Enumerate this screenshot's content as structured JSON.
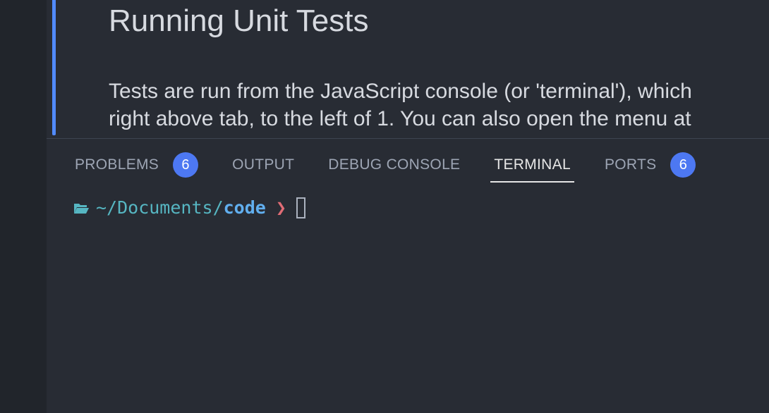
{
  "editor": {
    "heading": "Running Unit Tests",
    "paragraph_lines": [
      "Tests are run from the JavaScript console (or 'terminal'), which",
      "right above tab, to the left of 1. You can also open the menu at"
    ]
  },
  "panel": {
    "tabs": [
      {
        "label": "PROBLEMS",
        "badge": "6"
      },
      {
        "label": "OUTPUT"
      },
      {
        "label": "DEBUG CONSOLE"
      },
      {
        "label": "TERMINAL",
        "active": true
      },
      {
        "label": "PORTS",
        "badge": "6"
      }
    ]
  },
  "terminal": {
    "path_prefix": "~/Documents/",
    "path_current": "code",
    "prompt_symbol": "❯"
  },
  "colors": {
    "accent": "#528bff",
    "badge": "#4d78f2",
    "path": "#56b6c2",
    "prompt": "#e06c75"
  }
}
